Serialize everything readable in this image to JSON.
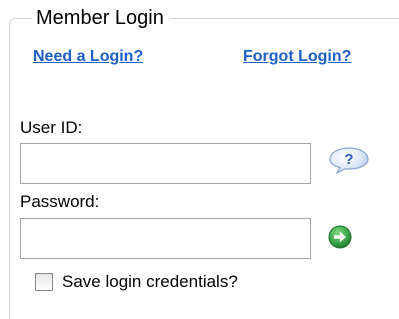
{
  "login": {
    "title": "Member Login",
    "need_login_link": "Need a Login?",
    "forgot_login_link": "Forgot Login?",
    "user_id_label": "User ID:",
    "user_id_value": "",
    "password_label": "Password:",
    "password_value": "",
    "remember_label": "Save login credentials?",
    "remember_checked": false
  },
  "icons": {
    "help": "question-speech-bubble-icon",
    "submit": "green-arrow-go-icon"
  },
  "colors": {
    "link": "#1d5fc4",
    "submit_green": "#3aa64a",
    "help_blue": "#2e5bb5"
  }
}
